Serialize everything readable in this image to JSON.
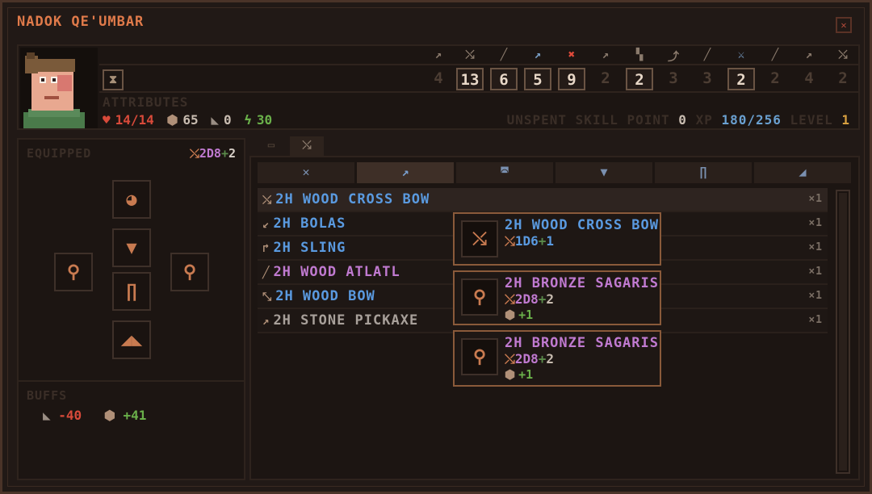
{
  "window": {
    "title": "NADOK QE'UMBAR",
    "close_icon": "close-icon"
  },
  "skills": {
    "icons": [
      "axe",
      "pick",
      "dagger",
      "spear",
      "hex",
      "bow",
      "hammer",
      "crossbow",
      "wand",
      "sword",
      "staff",
      "sling",
      "pickaxe"
    ],
    "values": [
      "4",
      "13",
      "6",
      "5",
      "9",
      "2",
      "2",
      "3",
      "3",
      "2",
      "2",
      "4",
      "2"
    ],
    "highlighted": [
      false,
      true,
      true,
      true,
      true,
      false,
      true,
      false,
      false,
      true,
      false,
      false,
      false
    ]
  },
  "attributes": {
    "label": "ATTRIBUTES",
    "hp": "14/14",
    "armor": "65",
    "weight": "0",
    "speed": "30"
  },
  "progress": {
    "unspent_label": "UNSPENT SKILL POINT",
    "unspent_value": "0",
    "xp_label": "XP",
    "xp_value": "180/256",
    "level_label": "LEVEL",
    "level_value": "1"
  },
  "equipped": {
    "label": "EQUIPPED",
    "damage": "2D8",
    "damage_bonus": "2"
  },
  "buffs": {
    "label": "BUFFS",
    "weight_buff": "-40",
    "armor_buff": "+41"
  },
  "inventory": {
    "items": [
      {
        "name": "2H WOOD CROSS BOW",
        "qty": "×1",
        "color": "#5a9ae0"
      },
      {
        "name": "2H BOLAS",
        "qty": "×1",
        "color": "#5a9ae0"
      },
      {
        "name": "2H SLING",
        "qty": "×1",
        "color": "#5a9ae0"
      },
      {
        "name": "2H WOOD ATLATL",
        "qty": "×1",
        "color": "#c07ad0"
      },
      {
        "name": "2H WOOD BOW",
        "qty": "×1",
        "color": "#5a9ae0"
      },
      {
        "name": "2H STONE PICKAXE",
        "qty": "×1",
        "color": "#a8a09a"
      }
    ]
  },
  "tooltips": [
    {
      "name": "2H WOOD CROSS BOW",
      "dice": "1D6",
      "bonus": "1",
      "armor": ""
    },
    {
      "name": "2H BRONZE SAGARIS",
      "dice": "2D8",
      "bonus": "2",
      "armor": "+1"
    },
    {
      "name": "2H BRONZE SAGARIS",
      "dice": "2D8",
      "bonus": "2",
      "armor": "+1"
    }
  ],
  "colors": {
    "accent": "#e07a4a",
    "rare": "#c07ad0",
    "uncommon": "#5a9ae0",
    "frame": "#8a5a3a"
  }
}
